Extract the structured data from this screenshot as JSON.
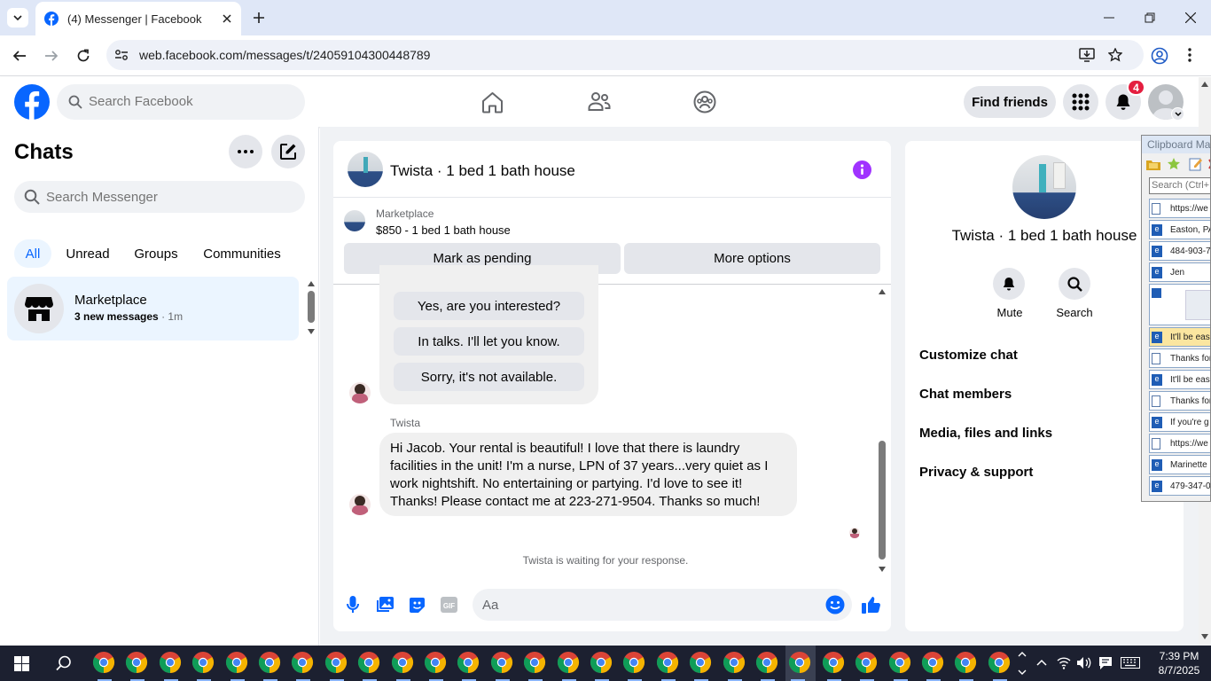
{
  "browser": {
    "tab_title": "(4) Messenger | Facebook",
    "url": "web.facebook.com/messages/t/24059104300448789"
  },
  "fb_nav": {
    "search_placeholder": "Search Facebook",
    "find_friends_label": "Find friends",
    "notification_count": "4"
  },
  "chats_panel": {
    "title": "Chats",
    "search_placeholder": "Search Messenger",
    "filters": [
      "All",
      "Unread",
      "Groups",
      "Communities"
    ],
    "chat_item": {
      "name": "Marketplace",
      "preview": "3 new messages",
      "time": "· 1m"
    }
  },
  "conversation": {
    "title": "Twista · 1 bed 1 bath house",
    "listing_label": "Marketplace",
    "listing_detail": "$850 - 1 bed 1 bath house",
    "mark_pending_label": "Mark as pending",
    "more_options_label": "More options",
    "quick_replies": [
      "Yes, are you interested?",
      "In talks. I'll let you know.",
      "Sorry, it's not available."
    ],
    "sender_name": "Twista",
    "message_lines": [
      "Hi Jacob. Your rental is  beautiful! I love that there is laundry",
      "facilities in the unit! I'm a nurse, LPN of 37 years...very quiet as I",
      "work nightshift. No entertaining or partying. I'd love to see it!",
      "Thanks! Please contact me at 223-271-9504. Thanks so much!"
    ],
    "waiting_text": "Twista is waiting for your response.",
    "composer_placeholder": "Aa"
  },
  "info_panel": {
    "title": "Twista · 1 bed 1 bath house",
    "mute_label": "Mute",
    "search_label": "Search",
    "menu": [
      "Customize chat",
      "Chat members",
      "Media, files and links",
      "Privacy & support"
    ]
  },
  "clipboard": {
    "title": "Clipboard Ma",
    "search_placeholder": "Search (Ctrl+F",
    "items": [
      "https://we",
      "Easton, PA",
      "484-903-7",
      "Jen",
      "It'll be eas",
      "Thanks for",
      "It'll be eas",
      "Thanks for",
      "If you're g",
      "https://we",
      "Marinette",
      "479-347-0"
    ]
  },
  "taskbar": {
    "time": "7:39 PM",
    "date": "8/7/2025"
  },
  "colors": {
    "fb_blue": "#0866ff",
    "accent_purple": "#a033ff",
    "badge_red": "#e41e3f"
  }
}
